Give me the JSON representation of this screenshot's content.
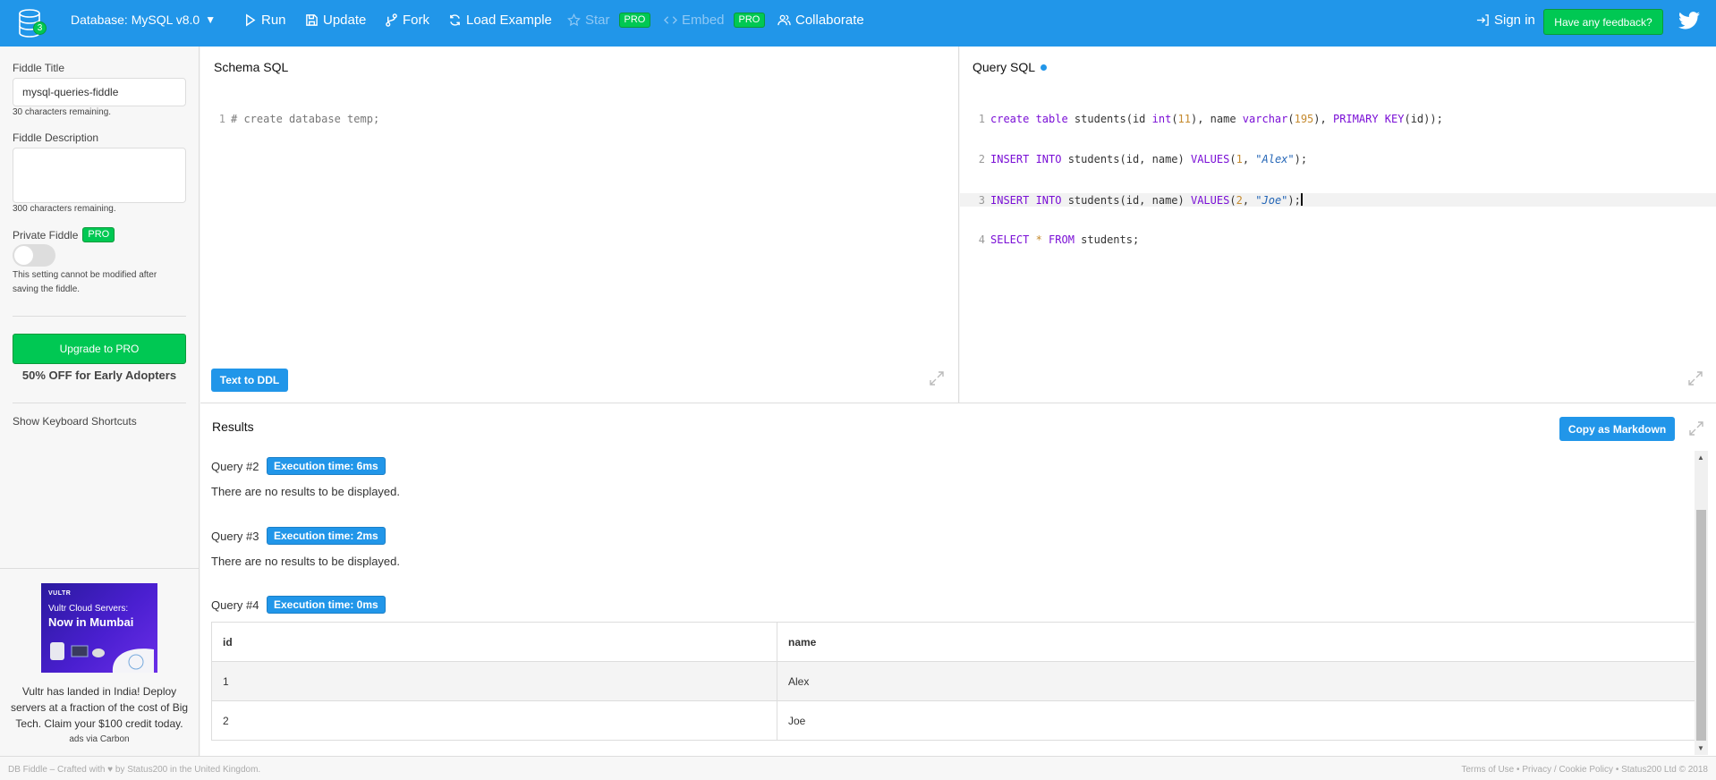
{
  "header": {
    "logo_badge": "3",
    "database_select": "Database: MySQL v8.0",
    "nav": [
      {
        "label": "Run",
        "icon": "play-icon",
        "disabled": false
      },
      {
        "label": "Update",
        "icon": "save-icon",
        "disabled": false
      },
      {
        "label": "Fork",
        "icon": "fork-icon",
        "disabled": false
      },
      {
        "label": "Load Example",
        "icon": "refresh-icon",
        "disabled": false
      },
      {
        "label": "Star",
        "icon": "star-icon",
        "disabled": true,
        "badge": "PRO"
      },
      {
        "label": "Embed",
        "icon": "code-icon",
        "disabled": true,
        "badge": "PRO"
      },
      {
        "label": "Collaborate",
        "icon": "users-icon",
        "disabled": false
      }
    ],
    "sign_in": "Sign in",
    "feedback": "Have any feedback?"
  },
  "sidebar": {
    "title_label": "Fiddle Title",
    "title_value": "mysql-queries-fiddle",
    "title_hint": "30 characters remaining.",
    "desc_label": "Fiddle Description",
    "desc_value": "",
    "desc_hint": "300 characters remaining.",
    "private_label": "Private Fiddle",
    "private_badge": "PRO",
    "private_on": false,
    "private_note": "This setting cannot be modified after saving the fiddle.",
    "upgrade": "Upgrade to PRO",
    "early": "50% OFF for Early Adopters",
    "shortcuts": "Show Keyboard Shortcuts",
    "ad": {
      "brand": "VULTR",
      "headline1": "Vultr Cloud Servers:",
      "headline2": "Now in Mumbai",
      "text": "Vultr has landed in India! Deploy servers at a fraction of the cost of Big Tech. Claim your $100 credit today.",
      "via": "ads via Carbon"
    }
  },
  "schema": {
    "title": "Schema SQL",
    "lines": [
      "# create database temp;"
    ],
    "text_to_ddl": "Text to DDL"
  },
  "query": {
    "title": "Query SQL",
    "lines": [
      "create table students(id int(11), name varchar(195), PRIMARY KEY(id));",
      "INSERT INTO students(id, name) VALUES(1, \"Alex\");",
      "INSERT INTO students(id, name) VALUES(2, \"Joe\");",
      "SELECT * FROM students;"
    ],
    "active_line": 3
  },
  "results": {
    "title": "Results",
    "copy_markdown": "Copy as Markdown",
    "queries": [
      {
        "label": "Query #2",
        "exec": "Execution time: 6ms",
        "message": "There are no results to be displayed."
      },
      {
        "label": "Query #3",
        "exec": "Execution time: 2ms",
        "message": "There are no results to be displayed."
      },
      {
        "label": "Query #4",
        "exec": "Execution time: 0ms"
      }
    ],
    "table": {
      "columns": [
        "id",
        "name"
      ],
      "rows": [
        [
          "1",
          "Alex"
        ],
        [
          "2",
          "Joe"
        ]
      ]
    }
  },
  "footer": {
    "left": "DB Fiddle – Crafted with ♥ by Status200 in the United Kingdom.",
    "terms": "Terms of Use",
    "privacy": "Privacy / Cookie Policy",
    "copyright": "Status200 Ltd © 2018",
    "sep": "•"
  }
}
